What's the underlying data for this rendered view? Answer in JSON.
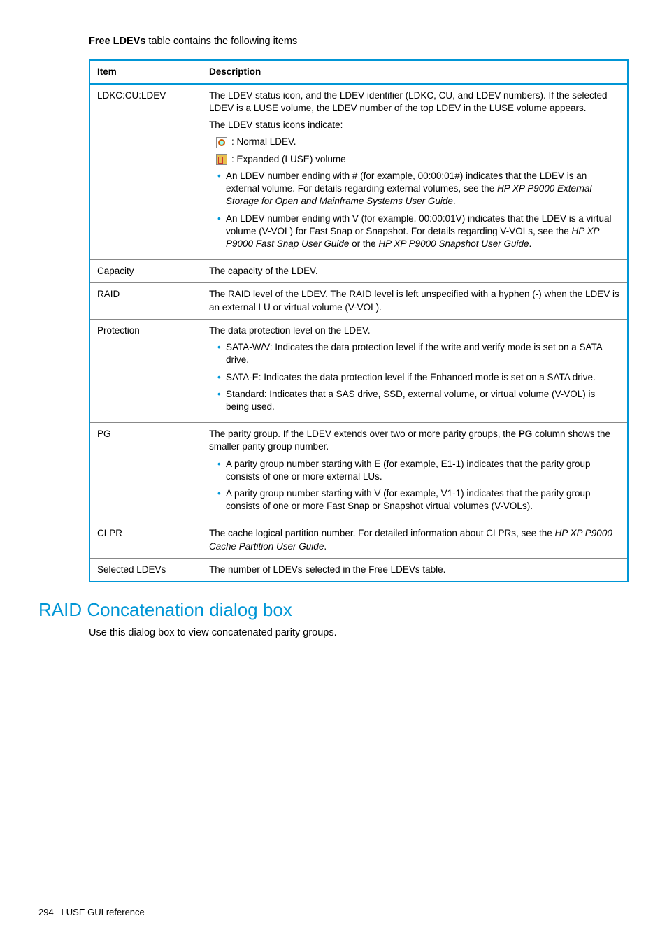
{
  "intro": {
    "bold": "Free LDEVs",
    "rest": " table contains the following items"
  },
  "headers": {
    "item": "Item",
    "desc": "Description"
  },
  "rows": {
    "ldkc": {
      "item": "LDKC:CU:LDEV",
      "p1": "The LDEV status icon, and the LDEV identifier (LDKC, CU, and LDEV numbers). If the selected LDEV is a LUSE volume, the LDEV number of the top LDEV in the LUSE volume appears.",
      "p2": "The LDEV status icons indicate:",
      "icon1": ": Normal LDEV.",
      "icon2": ": Expanded (LUSE) volume",
      "b1a": "An LDEV number ending with # (for example, 00:00:01#) indicates that the LDEV is an external volume. For details regarding external volumes, see the ",
      "b1i": "HP XP P9000 External Storage for Open and Mainframe Systems User Guide",
      "b1b": ".",
      "b2a": "An LDEV number ending with V (for example, 00:00:01V) indicates that the LDEV is a virtual volume (V-VOL) for Fast Snap or Snapshot. For details regarding V-VOLs, see the ",
      "b2i1": "HP XP P9000 Fast Snap User Guide",
      "b2m": " or the ",
      "b2i2": "HP XP P9000 Snapshot User Guide",
      "b2b": "."
    },
    "capacity": {
      "item": "Capacity",
      "desc": "The capacity of the LDEV."
    },
    "raid": {
      "item": "RAID",
      "desc": "The RAID level of the LDEV. The RAID level is left unspecified with a hyphen (-) when the LDEV is an external LU or virtual volume (V-VOL)."
    },
    "protection": {
      "item": "Protection",
      "p1": "The data protection level on the LDEV.",
      "b1": "SATA-W/V: Indicates the data protection level if the write and verify mode is set on a SATA drive.",
      "b2": "SATA-E: Indicates the data protection level if the Enhanced mode is set on a SATA drive.",
      "b3": "Standard: Indicates that a SAS drive, SSD, external volume, or virtual volume (V-VOL) is being used."
    },
    "pg": {
      "item": "PG",
      "p1a": "The parity group. If the LDEV extends over two or more parity groups, the ",
      "p1bold": "PG",
      "p1b": " column shows the smaller parity group number.",
      "b1": "A parity group number starting with E (for example, E1-1) indicates that the parity group consists of one or more external LUs.",
      "b2": "A parity group number starting with V (for example, V1-1) indicates that the parity group consists of one or more Fast Snap or Snapshot virtual volumes (V-VOLs)."
    },
    "clpr": {
      "item": "CLPR",
      "a": "The cache logical partition number. For detailed information about CLPRs, see the ",
      "i": "HP XP P9000 Cache Partition User Guide",
      "b": "."
    },
    "selected": {
      "item": "Selected LDEVs",
      "desc": "The number of LDEVs selected in the Free LDEVs table."
    }
  },
  "section": {
    "title": "RAID Concatenation dialog box",
    "body": "Use this dialog box to view concatenated parity groups."
  },
  "footer": {
    "page": "294",
    "label": "LUSE GUI reference"
  }
}
